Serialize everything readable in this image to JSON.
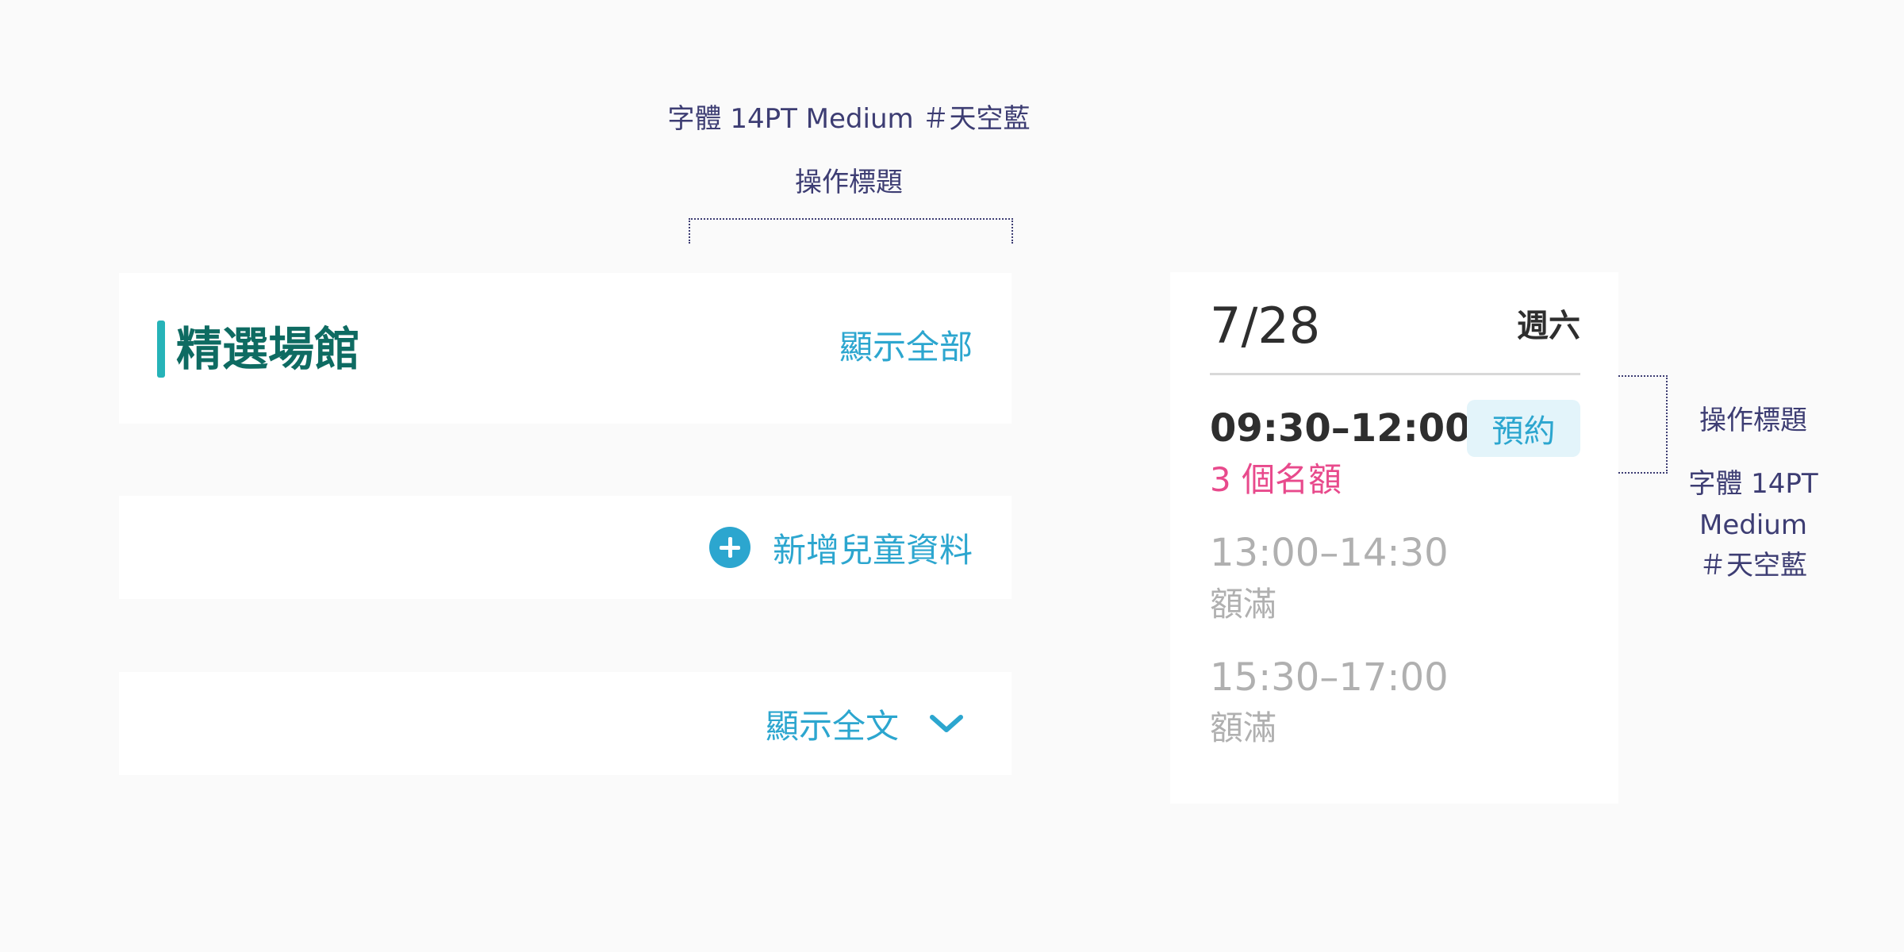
{
  "annotations": {
    "top_spec": "字體 14PT Medium ＃天空藍",
    "top_label": "操作標題",
    "right_label": "操作標題",
    "right_spec_lines": [
      "字體 14PT",
      "Medium",
      "＃天空藍"
    ]
  },
  "featured_card": {
    "title": "精選場館",
    "action_label": "顯示全部"
  },
  "add_card": {
    "icon": "plus-circle-icon",
    "label": "新增兒童資料"
  },
  "expand_card": {
    "label": "顯示全文",
    "icon": "chevron-down-icon"
  },
  "schedule": {
    "date": "7/28",
    "weekday": "週六",
    "slots": [
      {
        "time": "09:30–12:00",
        "status": "3 個名額",
        "action": "預約"
      },
      {
        "time": "13:00–14:30",
        "status": "額滿"
      },
      {
        "time": "15:30–17:00",
        "status": "額滿"
      }
    ]
  },
  "colors": {
    "sky_blue": "#2ca6cf",
    "teal_title": "#0e6b62",
    "accent_bar": "#26b3b8",
    "availability_pink": "#e84a8c",
    "disabled_gray": "#b0b0b0",
    "annotation_navy": "#3d3d73"
  }
}
